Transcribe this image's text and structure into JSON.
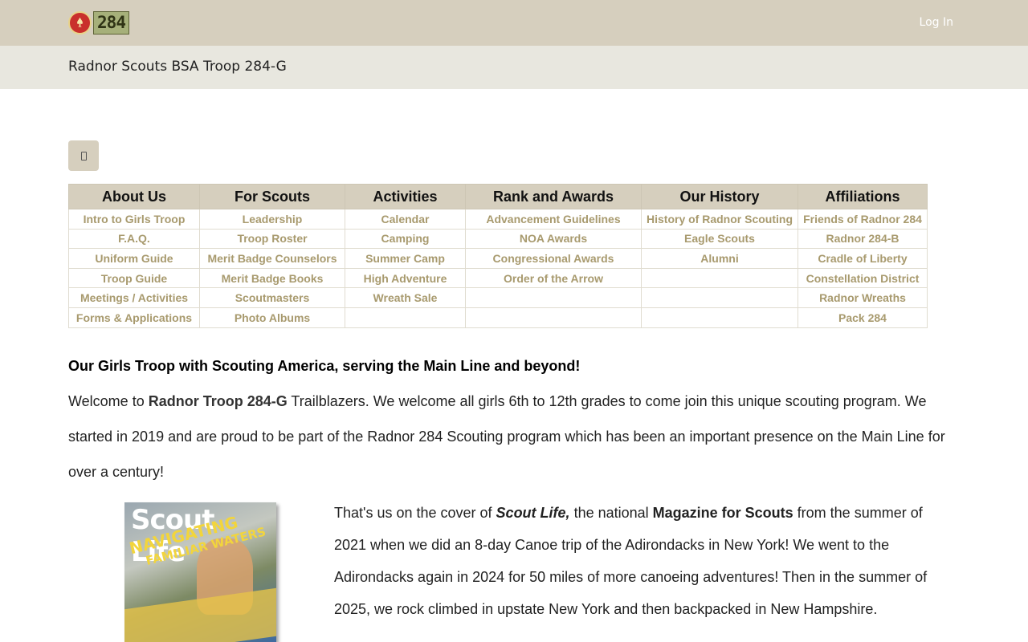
{
  "header": {
    "logo_number": "284",
    "login_label": "Log In"
  },
  "subheader": {
    "title": "Radnor Scouts BSA Troop 284-G"
  },
  "menu_button": {
    "icon": "menu-icon"
  },
  "nav": {
    "columns": [
      {
        "heading": "About Us",
        "items": [
          "Intro to Girls Troop",
          "F.A.Q.",
          "Uniform Guide",
          "Troop Guide",
          "Meetings / Activities",
          "Forms & Applications"
        ]
      },
      {
        "heading": "For Scouts",
        "items": [
          "Leadership",
          "Troop Roster",
          "Merit Badge Counselors",
          "Merit Badge Books",
          "Scoutmasters",
          "Photo Albums"
        ]
      },
      {
        "heading": "Activities",
        "items": [
          "Calendar",
          "Camping",
          "Summer Camp",
          "High Adventure",
          "Wreath Sale",
          ""
        ]
      },
      {
        "heading": "Rank and Awards",
        "items": [
          "Advancement Guidelines",
          "NOA Awards",
          "Congressional Awards",
          "Order of the Arrow",
          "",
          ""
        ]
      },
      {
        "heading": "Our History",
        "items": [
          "History of Radnor Scouting",
          "Eagle Scouts",
          "Alumni",
          "",
          "",
          ""
        ]
      },
      {
        "heading": "Affiliations",
        "items": [
          "Friends of Radnor 284",
          "Radnor 284-B",
          "Cradle of Liberty",
          "Constellation District",
          "Radnor Wreaths",
          "Pack 284"
        ]
      }
    ]
  },
  "intro": {
    "headline": "Our Girls Troop with Scouting America, serving the Main Line and beyond!",
    "p1_a": "Welcome to ",
    "p1_b": "Radnor Troop 284-G",
    "p1_c": " Trailblazers. We welcome all girls 6th to 12th grades to come join this unique scouting program.  We started in 2019 and are proud to be part of the Radnor 284 Scouting program which has been an important presence on the Main Line for over a century!"
  },
  "cover": {
    "title": "Scout Life",
    "sub1": "NAVIGATING",
    "sub2": "FAMILIAR WATERS"
  },
  "story": {
    "a": "That's us on the cover of ",
    "b": "Scout Life,",
    "c": "  the national ",
    "d": "Magazine for Scouts",
    "e": " from the summer of 2021 when we did an 8-day Canoe trip of the Adirondacks in New York! We went to the Adirondacks again in 2024 for 50 miles of more canoeing adventures! Then in the summer of 2025, we rock climbed in upstate New York and then backpacked in New Hampshire."
  }
}
